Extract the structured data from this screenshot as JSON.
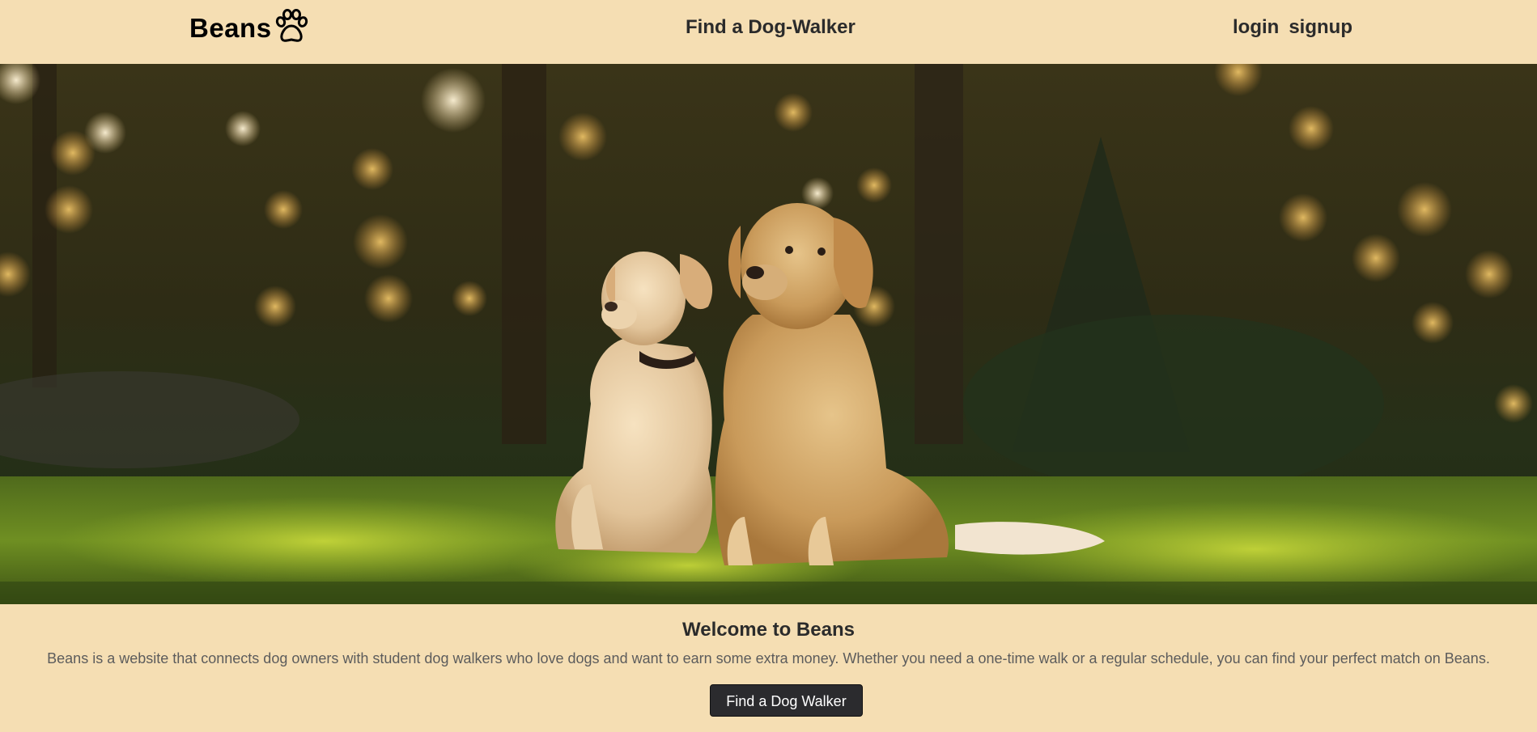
{
  "nav": {
    "brand": "Beans",
    "brand_icon": "paw-icon",
    "center_link": "Find a Dog-Walker",
    "login": "login",
    "signup": "signup"
  },
  "hero": {
    "image": "two-dogs-sitting-on-sunlit-grass-photo"
  },
  "welcome": {
    "title": "Welcome to Beans",
    "text": "Beans is a website that connects dog owners with student dog walkers who love dogs and want to earn some extra money. Whether you need a one-time walk or a regular schedule, you can find your perfect match on Beans.",
    "button": "Find a Dog Walker"
  },
  "colors": {
    "background": "#f5deb3",
    "text": "#2b2b2b",
    "button": "#2b2b2e"
  }
}
